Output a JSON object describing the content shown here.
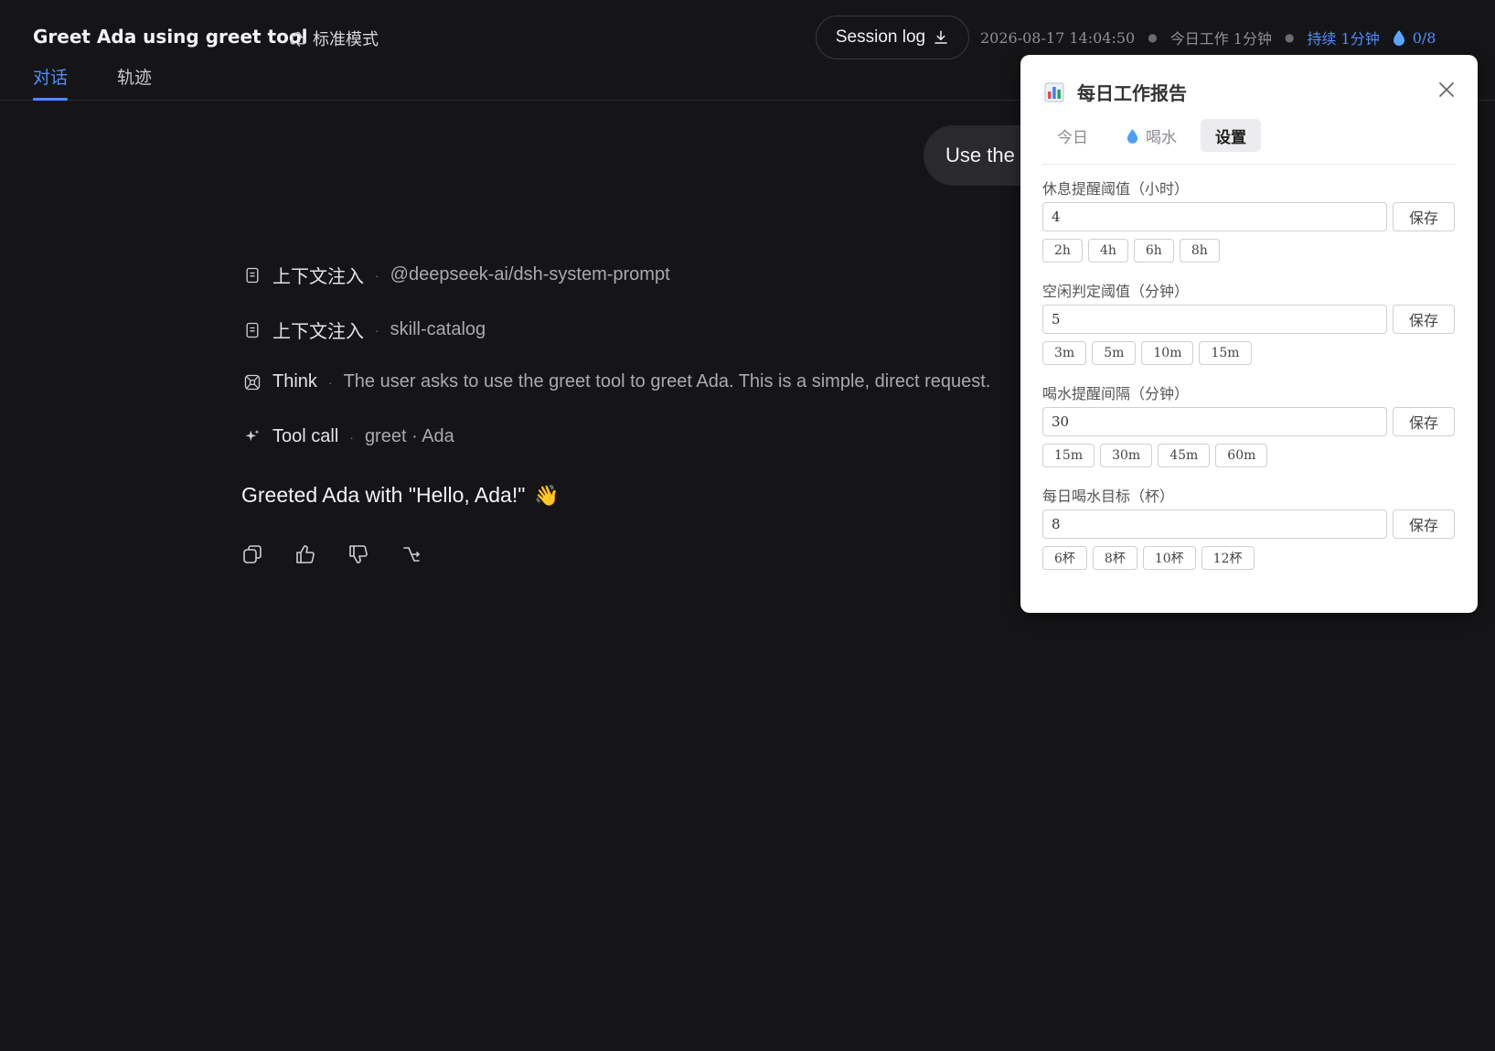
{
  "header": {
    "title": "Greet Ada using greet tool",
    "mode_label": "标准模式",
    "tabs": [
      {
        "label": "对话",
        "active": true
      },
      {
        "label": "轨迹",
        "active": false
      }
    ],
    "session_log_label": "Session log",
    "timestamp": "2026-08-17 14:04:50",
    "work_today": "今日工作 1分钟",
    "duration": "持续 1分钟",
    "water_count": "0/8"
  },
  "chat": {
    "user_message": "Use the greet tool to greet Ada",
    "trace": [
      {
        "icon": "document-icon",
        "label": "上下文注入",
        "value": "@deepseek-ai/dsh-system-prompt"
      },
      {
        "icon": "document-icon",
        "label": "上下文注入",
        "value": "skill-catalog"
      },
      {
        "icon": "think-icon",
        "label": "Think",
        "value": "The user asks to use the greet tool to greet Ada. This is a simple, direct request."
      },
      {
        "icon": "sparkle-icon",
        "label": "Tool call",
        "value": "greet · Ada"
      }
    ],
    "answer": "Greeted Ada with \"Hello, Ada!\"",
    "answer_emoji": "👋"
  },
  "panel": {
    "title": "每日工作报告",
    "tabs": [
      {
        "label": "今日",
        "active": false
      },
      {
        "label": "喝水",
        "active": false
      },
      {
        "label": "设置",
        "active": true
      }
    ],
    "settings": [
      {
        "label": "休息提醒阈值（小时）",
        "value": "4",
        "save": "保存",
        "chips": [
          "2h",
          "4h",
          "6h",
          "8h"
        ]
      },
      {
        "label": "空闲判定阈值（分钟）",
        "value": "5",
        "save": "保存",
        "chips": [
          "3m",
          "5m",
          "10m",
          "15m"
        ]
      },
      {
        "label": "喝水提醒间隔（分钟）",
        "value": "30",
        "save": "保存",
        "chips": [
          "15m",
          "30m",
          "45m",
          "60m"
        ]
      },
      {
        "label": "每日喝水目标（杯）",
        "value": "8",
        "save": "保存",
        "chips": [
          "6杯",
          "8杯",
          "10杯",
          "12杯"
        ]
      }
    ]
  },
  "colors": {
    "background": "#151517",
    "accent": "#4d8dff",
    "panel_bg": "#ffffff"
  }
}
